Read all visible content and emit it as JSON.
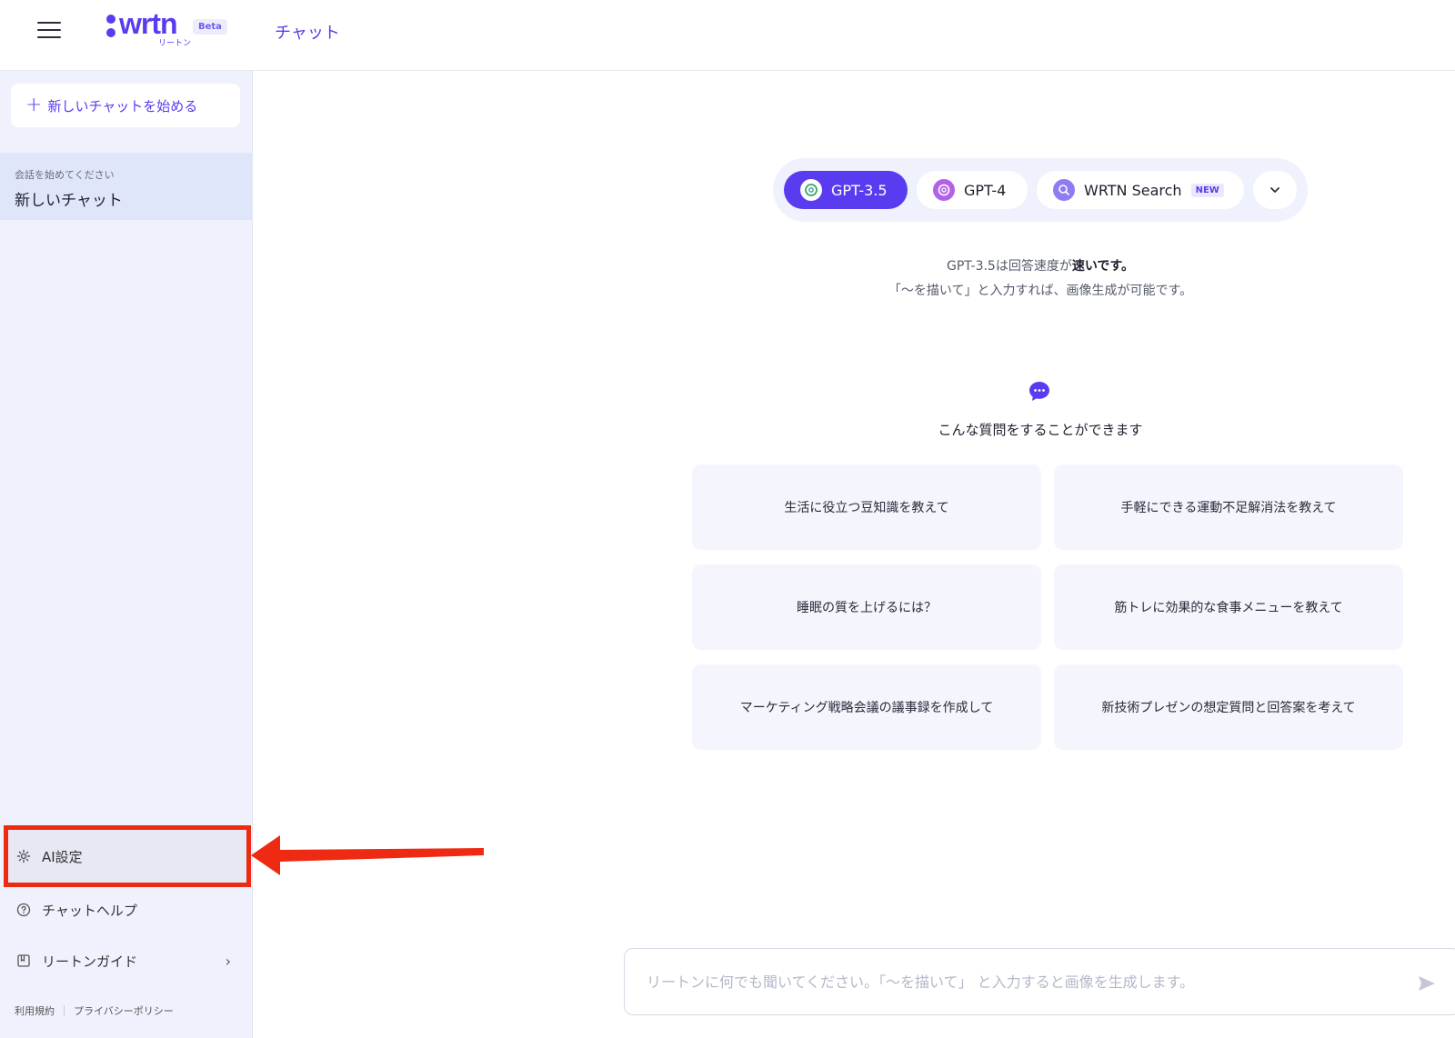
{
  "header": {
    "logo_word": "wrtn",
    "logo_sub": "リートン",
    "beta_label": "Beta",
    "title": "チャット"
  },
  "sidebar": {
    "new_chat_label": "新しいチャットを始める",
    "chat_item": {
      "subtitle": "会話を始めてください",
      "title": "新しいチャット"
    },
    "links": {
      "ai_settings": "AI設定",
      "chat_help": "チャットヘルプ",
      "guide": "リートンガイド"
    },
    "footer": {
      "terms": "利用規約",
      "privacy": "プライバシーポリシー"
    }
  },
  "models": {
    "items": [
      {
        "label": "GPT-3.5",
        "active": true,
        "icon": "openai-icon"
      },
      {
        "label": "GPT-4",
        "active": false,
        "icon": "openai-icon"
      },
      {
        "label": "WRTN Search",
        "active": false,
        "icon": "search-icon",
        "badge": "NEW"
      }
    ]
  },
  "description": {
    "line1_prefix": "GPT-3.5は回答速度が",
    "line1_emph": "速いです。",
    "line2": "「〜を描いて」と入力すれば、画像生成が可能です。"
  },
  "suggestions": {
    "title": "こんな質問をすることができます",
    "cards": [
      "生活に役立つ豆知識を教えて",
      "手軽にできる運動不足解消法を教えて",
      "睡眠の質を上げるには？",
      "筋トレに効果的な食事メニューを教えて",
      "マーケティング戦略会議の議事録を作成して",
      "新技術プレゼンの想定質問と回答案を考えて"
    ]
  },
  "composer": {
    "placeholder": "リートンに何でも聞いてください。「〜を描いて」 と入力すると画像を生成します。"
  },
  "colors": {
    "accent": "#5a3cf0",
    "highlight": "#ee2a12"
  }
}
